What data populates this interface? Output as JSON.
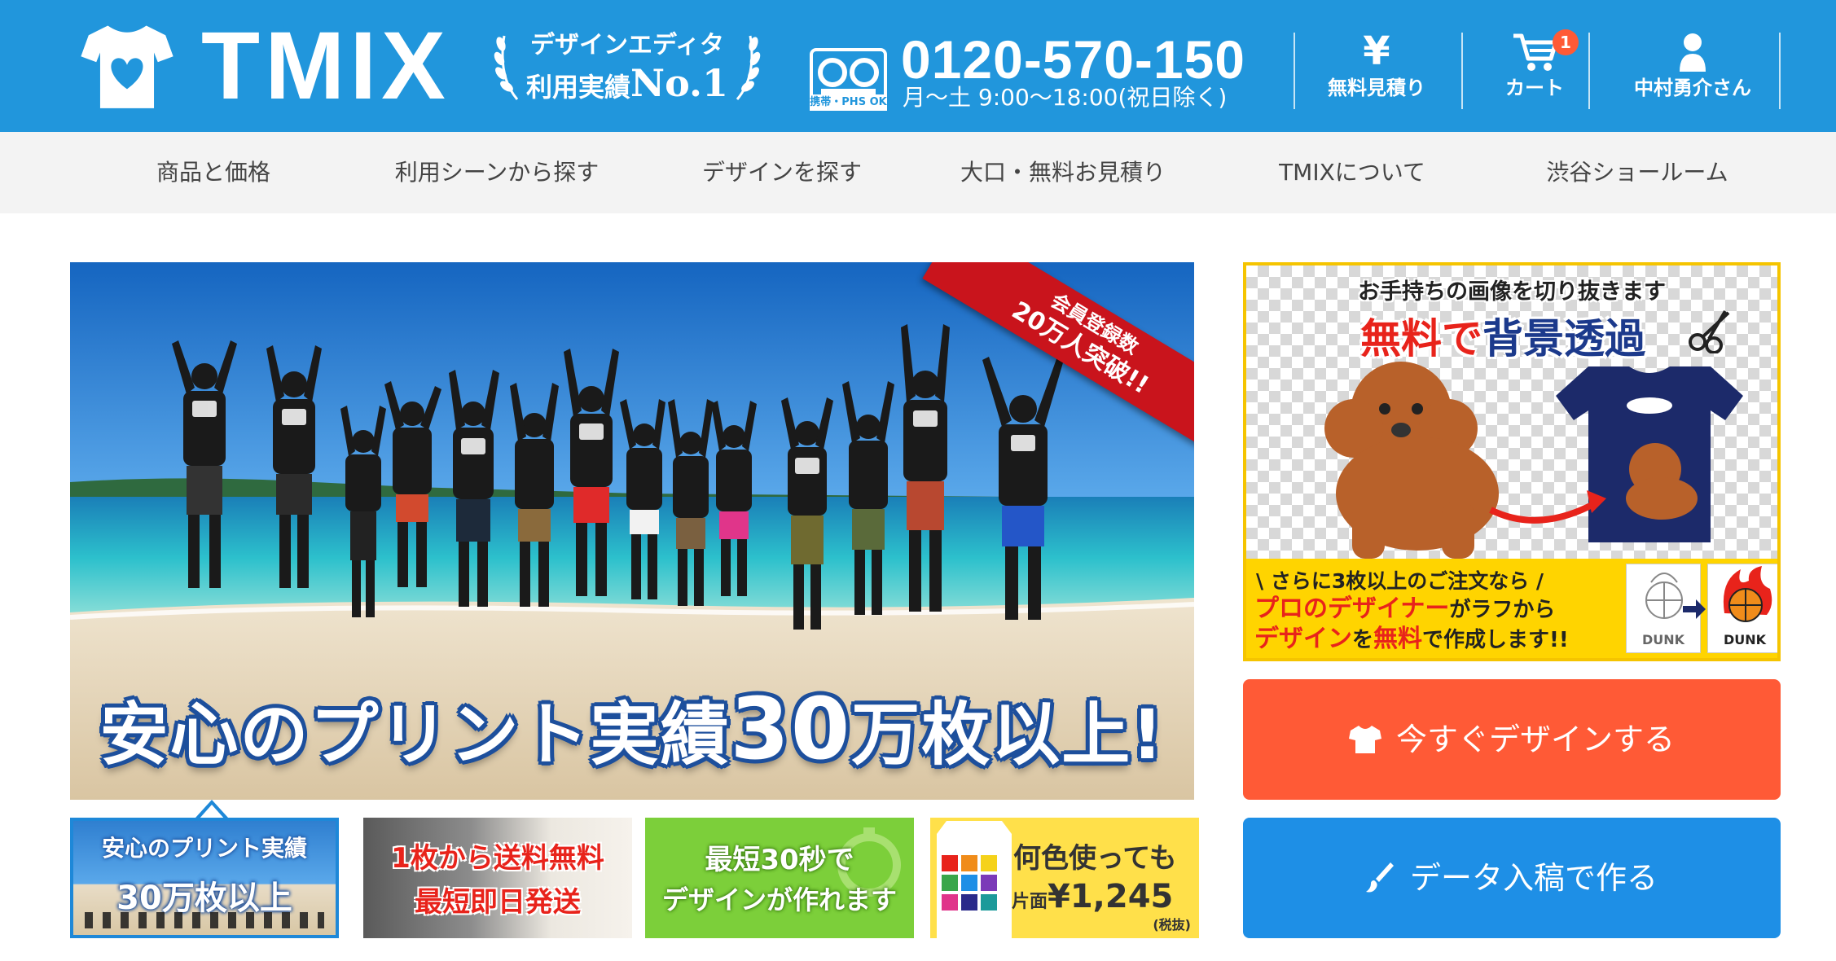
{
  "header": {
    "brand": "TMIX",
    "award": {
      "line1": "デザインエディタ",
      "line2_prefix": "利用実績",
      "line2_rank": "No.1"
    },
    "phone": {
      "number": "0120-570-150",
      "hours": "月〜土 9:00〜18:00(祝日除く)",
      "phs_label": "携帯・PHS OK"
    },
    "buttons": [
      {
        "icon": "yen-icon",
        "glyph": "¥",
        "label": "無料見積り"
      },
      {
        "icon": "cart-icon",
        "label": "カート",
        "badge": "1"
      },
      {
        "icon": "user-icon",
        "label": "中村勇介さん"
      }
    ],
    "colors": {
      "background": "#2196dc"
    }
  },
  "nav": {
    "items": [
      {
        "label": "商品と価格"
      },
      {
        "label": "利用シーンから探す"
      },
      {
        "label": "デザインを探す"
      },
      {
        "label": "大口・無料お見積り"
      },
      {
        "label": "TMIXについて"
      },
      {
        "label": "渋谷ショールーム"
      }
    ]
  },
  "hero": {
    "ribbon_line1": "会員登録数",
    "ribbon_line2": "20万人突破!!",
    "caption_prefix": "安心のプリント実績",
    "caption_number": "30",
    "caption_suffix": "万枚以上!"
  },
  "thumbs": [
    {
      "line1": "安心のプリント実績",
      "line2": "30万枚以上"
    },
    {
      "line1": "1枚から送料無料",
      "line2": "最短即日発送"
    },
    {
      "line1": "最短30秒で",
      "line2": "デザインが作れます"
    },
    {
      "line1": "何色使っても",
      "line2_prefix": "片面",
      "line2_price": "¥1,245",
      "line3": "(税抜)"
    }
  ],
  "promo": {
    "headline1": "お手持ちの画像を切り抜きます",
    "headline2_red": "無料で",
    "headline2_dark": "背景透過",
    "bottom_line1": "\\ さらに3枚以上のご注文なら /",
    "bottom_line2_a": "プロのデザイナー",
    "bottom_line2_b": "がラフから",
    "bottom_line3_a": "デザイン",
    "bottom_line3_b": "を",
    "bottom_line3_c": "無料",
    "bottom_line3_d": "で作成します!!",
    "dunk_label": "DUNK"
  },
  "cta": {
    "design_label": "今すぐデザインする",
    "upload_label": "データ入稿で作る",
    "colors": {
      "design": "#ff5a36",
      "upload": "#1e8fe6"
    }
  }
}
